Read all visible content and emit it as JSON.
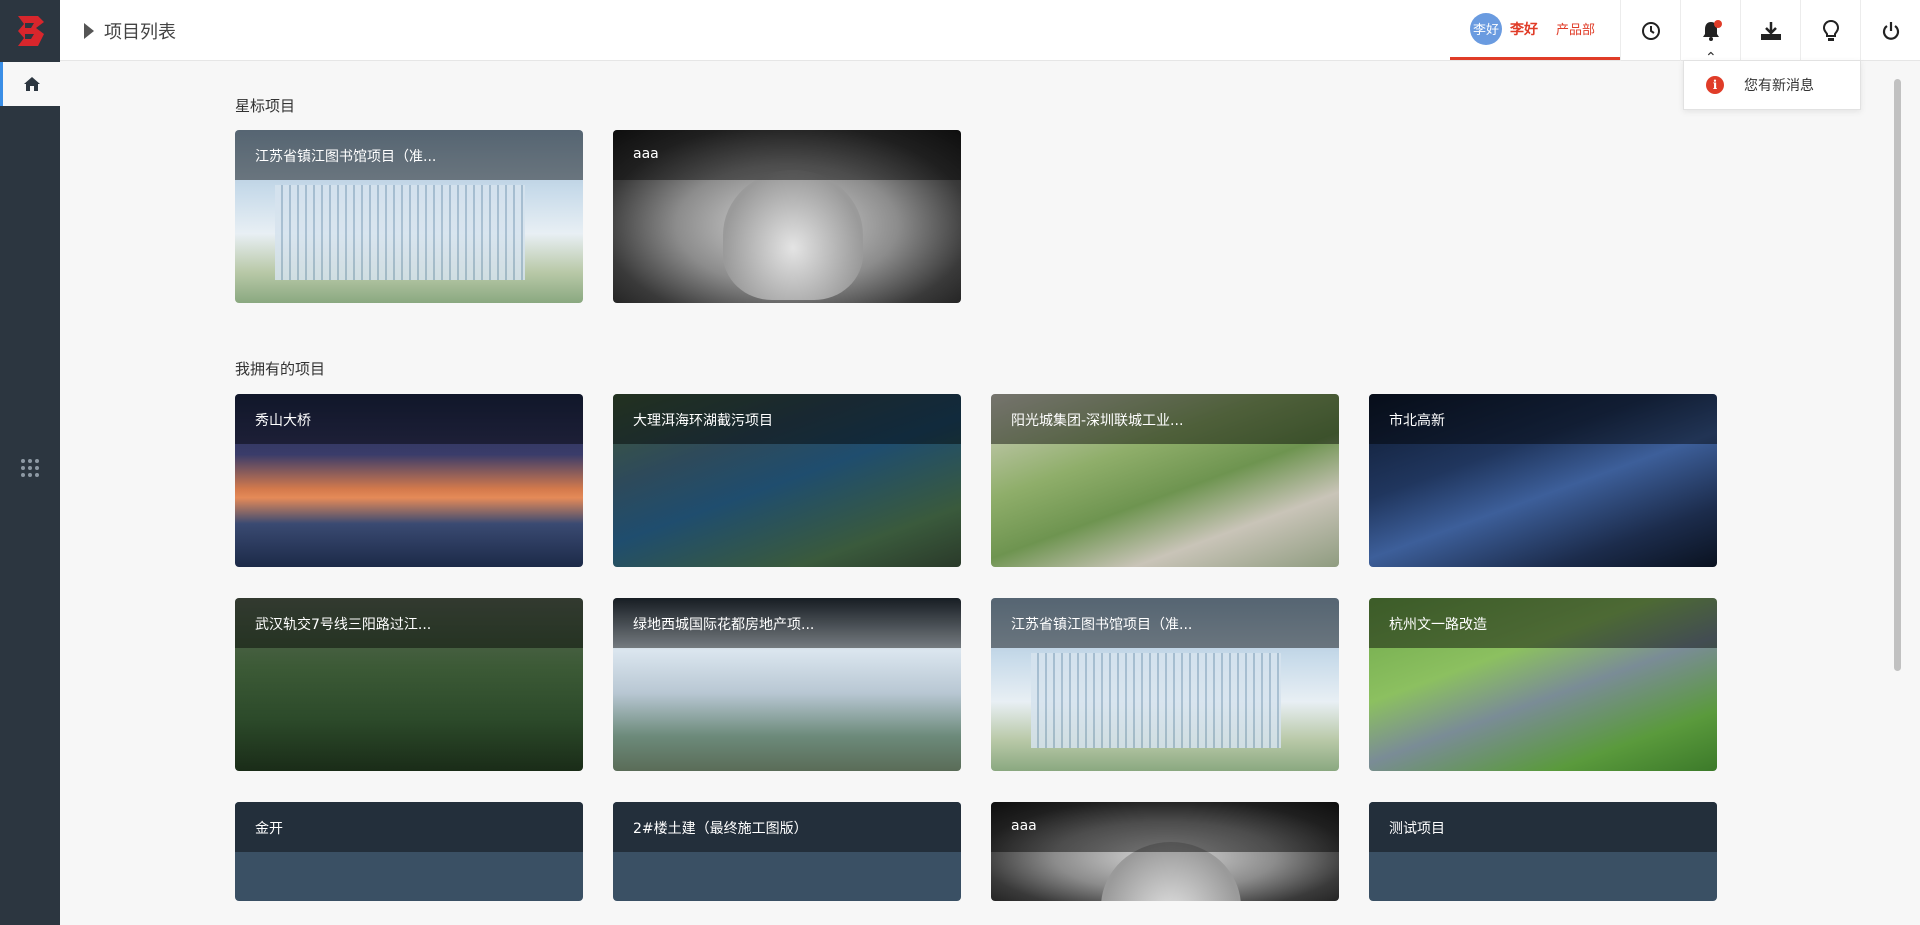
{
  "header": {
    "breadcrumb_title": "项目列表",
    "user": {
      "avatar_text": "李好",
      "name": "李好",
      "department": "产品部"
    }
  },
  "notification_dropdown": {
    "message": "您有新消息"
  },
  "sections": {
    "starred_title": "星标项目",
    "owned_title": "我拥有的项目"
  },
  "starred_projects": [
    {
      "name": "江苏省镇江图书馆项目（准..."
    },
    {
      "name": "aaa"
    }
  ],
  "owned_projects": [
    {
      "name": "秀山大桥"
    },
    {
      "name": "大理洱海环湖截污项目"
    },
    {
      "name": "阳光城集团-深圳联城工业..."
    },
    {
      "name": "市北高新"
    },
    {
      "name": "武汉轨交7号线三阳路过江..."
    },
    {
      "name": "绿地西城国际花都房地产项..."
    },
    {
      "name": "江苏省镇江图书馆项目（准..."
    },
    {
      "name": "杭州文一路改造"
    },
    {
      "name": "金开"
    },
    {
      "name": "2#楼土建（最终施工图版）"
    },
    {
      "name": "aaa"
    },
    {
      "name": "测试项目"
    }
  ],
  "colors": {
    "accent": "#e03c28",
    "sidebar": "#2c3640",
    "active": "#3a8ee6"
  },
  "icons": [
    "logo-icon",
    "home-icon",
    "apps-grid-icon",
    "history-icon",
    "bell-icon",
    "download-icon",
    "lightbulb-icon",
    "power-icon",
    "info-icon"
  ]
}
